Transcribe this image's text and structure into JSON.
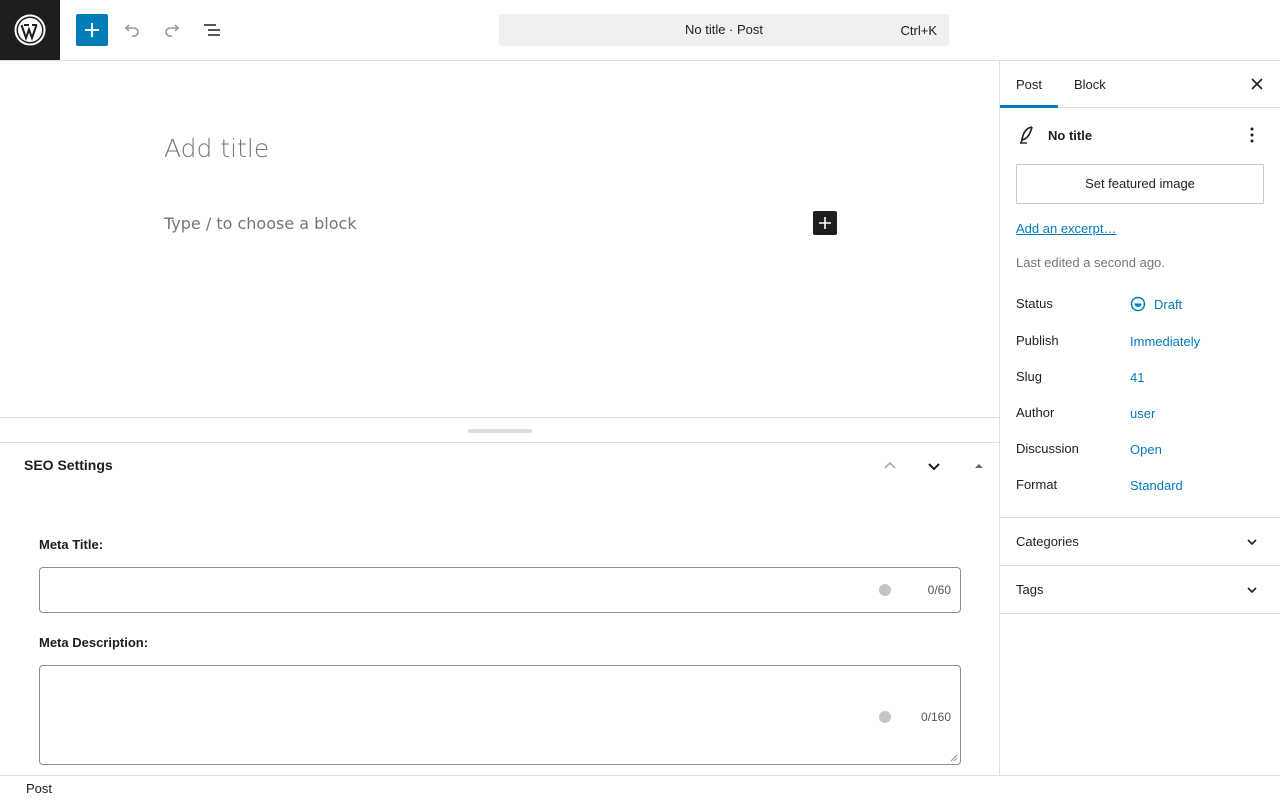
{
  "topbar": {
    "logo_label": "WordPress",
    "command": {
      "title": "No title · Post",
      "shortcut": "Ctrl+K"
    }
  },
  "editor": {
    "title_placeholder": "Add title",
    "block_placeholder": "Type / to choose a block"
  },
  "seo": {
    "panel_title": "SEO Settings",
    "meta_title_label": "Meta Title:",
    "meta_title_value": "",
    "meta_title_counter": "0/60",
    "meta_description_label": "Meta Description:",
    "meta_description_value": "",
    "meta_description_counter": "0/160"
  },
  "footer": {
    "breadcrumb": "Post"
  },
  "sidebar": {
    "tabs": [
      {
        "label": "Post",
        "active": true
      },
      {
        "label": "Block",
        "active": false
      }
    ],
    "post_title": "No title",
    "featured_image_button": "Set featured image",
    "excerpt_link": "Add an excerpt…",
    "last_edited": "Last edited a second ago.",
    "rows": [
      {
        "label": "Status",
        "value": "Draft"
      },
      {
        "label": "Publish",
        "value": "Immediately"
      },
      {
        "label": "Slug",
        "value": "41"
      },
      {
        "label": "Author",
        "value": "user"
      },
      {
        "label": "Discussion",
        "value": "Open"
      },
      {
        "label": "Format",
        "value": "Standard"
      }
    ],
    "panels": [
      {
        "title": "Categories"
      },
      {
        "title": "Tags"
      }
    ]
  },
  "colors": {
    "accent": "#007cba",
    "dark": "#1e1e1e",
    "border": "#e0e0e0",
    "muted": "#757575"
  },
  "icons": [
    "wordpress-logo-icon",
    "plus-icon",
    "undo-icon",
    "redo-icon",
    "list-view-icon",
    "close-icon",
    "feather-icon",
    "more-vertical-icon",
    "draft-status-icon",
    "chevron-up-icon",
    "chevron-down-icon",
    "triangle-up-icon"
  ]
}
